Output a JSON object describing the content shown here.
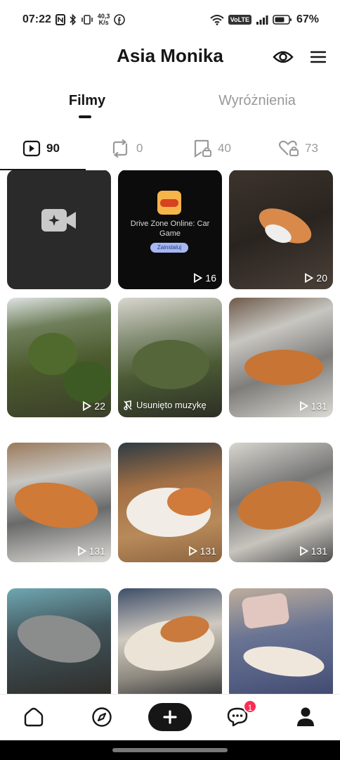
{
  "status_bar": {
    "time": "07:22",
    "speed_value": "40,3",
    "speed_unit": "K/s",
    "volte": "VoLTE",
    "battery": "67%"
  },
  "header": {
    "title": "Asia Monika",
    "icons": [
      "eye-icon",
      "menu-icon"
    ]
  },
  "tabs": [
    {
      "label": "Filmy",
      "active": true
    },
    {
      "label": "Wyróżnienia",
      "active": false
    }
  ],
  "stats": {
    "videos": "90",
    "reposts": "0",
    "saved": "40",
    "liked": "73"
  },
  "grid": [
    {
      "type": "draft"
    },
    {
      "type": "ad",
      "title": "Drive Zone Online: Car Game",
      "button": "Zainstaluj",
      "views": "16"
    },
    {
      "views": "20"
    },
    {
      "views": "22"
    },
    {
      "label": "Usunięto muzykę"
    },
    {
      "views": "131"
    },
    {
      "views": "131"
    },
    {
      "views": "131"
    },
    {
      "views": "131"
    },
    {},
    {},
    {}
  ],
  "bottom_nav": {
    "items": [
      "home-icon",
      "explore-icon",
      "plus-icon",
      "messages-icon",
      "profile-icon"
    ],
    "messages_badge": "1"
  },
  "colors": {
    "accent": "#fe2c55",
    "text": "#161616",
    "muted": "#9a9a9a"
  }
}
